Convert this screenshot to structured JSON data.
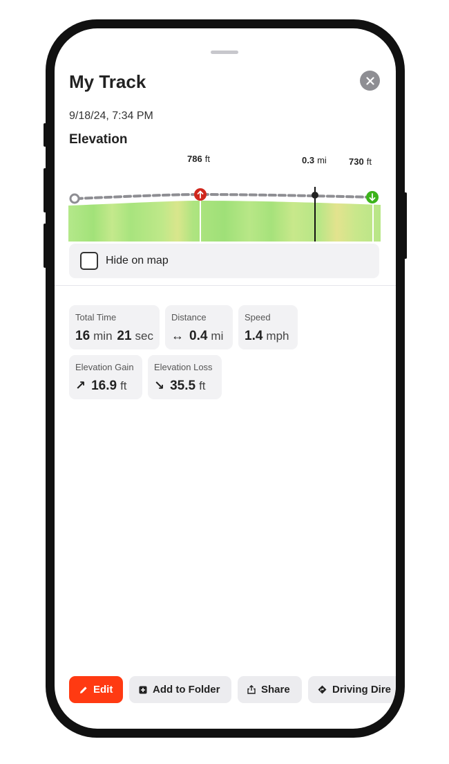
{
  "sheet": {
    "title": "My Track",
    "date": "9/18/24, 7:34 PM",
    "elevation_title": "Elevation"
  },
  "chart_markers": {
    "high": {
      "value": "786",
      "unit": "ft"
    },
    "cursor": {
      "value": "0.3",
      "unit": "mi"
    },
    "end": {
      "value": "730",
      "unit": "ft"
    }
  },
  "hide_on_map": {
    "label": "Hide on map",
    "checked": false
  },
  "stats": {
    "total_time": {
      "label": "Total Time",
      "min": "16",
      "min_unit": "min",
      "sec": "21",
      "sec_unit": "sec"
    },
    "distance": {
      "label": "Distance",
      "icon": "↔",
      "value": "0.4",
      "unit": "mi"
    },
    "speed": {
      "label": "Speed",
      "value": "1.4",
      "unit": "mph"
    },
    "elevation_gain": {
      "label": "Elevation Gain",
      "icon": "↗",
      "value": "16.9",
      "unit": "ft"
    },
    "elevation_loss": {
      "label": "Elevation Loss",
      "icon": "↘",
      "value": "35.5",
      "unit": "ft"
    }
  },
  "actions": {
    "edit": "Edit",
    "add_to_folder": "Add to Folder",
    "share": "Share",
    "driving_directions": "Driving Dire"
  },
  "colors": {
    "accent": "#ff3a12",
    "high_marker": "#d0271d",
    "end_marker": "#3bb31a",
    "gradient_green": "#a6e67a",
    "gradient_yellow": "#e6e68a"
  },
  "icons": {
    "close": "close-icon",
    "edit": "pencil-icon",
    "folder": "add-folder-icon",
    "share": "share-icon",
    "directions": "directions-icon"
  }
}
